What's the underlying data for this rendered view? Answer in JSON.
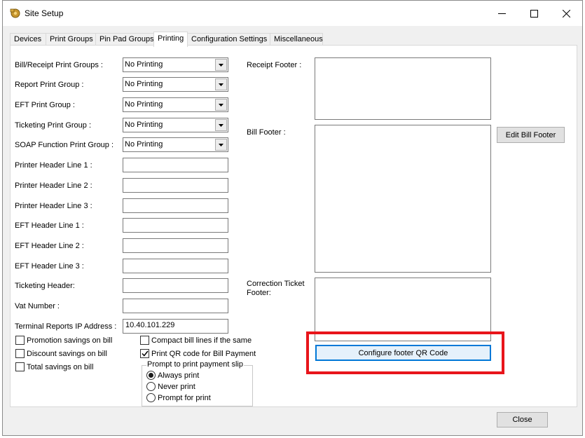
{
  "window": {
    "title": "Site Setup"
  },
  "tabs": [
    {
      "label": "Devices",
      "active": false
    },
    {
      "label": "Print Groups",
      "active": false
    },
    {
      "label": "Pin Pad Groups",
      "active": false
    },
    {
      "label": "Printing",
      "active": true
    },
    {
      "label": "Configuration Settings",
      "active": false
    },
    {
      "label": "Miscellaneous",
      "active": false
    }
  ],
  "form": {
    "bill_receipt_print_groups": {
      "label": "Bill/Receipt Print Groups :",
      "value": "No Printing"
    },
    "report_print_group": {
      "label": "Report Print Group :",
      "value": "No Printing"
    },
    "eft_print_group": {
      "label": "EFT Print Group :",
      "value": "No Printing"
    },
    "ticketing_print_group": {
      "label": "Ticketing Print Group :",
      "value": "No Printing"
    },
    "soap_function_print_group": {
      "label": "SOAP Function Print Group :",
      "value": "No Printing"
    },
    "printer_header_line_1": {
      "label": "Printer Header Line 1 :",
      "value": ""
    },
    "printer_header_line_2": {
      "label": "Printer Header Line 2 :",
      "value": ""
    },
    "printer_header_line_3": {
      "label": "Printer Header Line 3 :",
      "value": ""
    },
    "eft_header_line_1": {
      "label": "EFT Header Line 1 :",
      "value": ""
    },
    "eft_header_line_2": {
      "label": "EFT Header Line 2 :",
      "value": ""
    },
    "eft_header_line_3": {
      "label": "EFT Header Line 3 :",
      "value": ""
    },
    "ticketing_header": {
      "label": "Ticketing Header:",
      "value": ""
    },
    "vat_number": {
      "label": "Vat Number :",
      "value": ""
    },
    "terminal_reports_ip": {
      "label": "Terminal Reports IP Address :",
      "value": "10.40.101.229"
    }
  },
  "footers": {
    "receipt_footer": {
      "label": "Receipt Footer :",
      "value": ""
    },
    "bill_footer": {
      "label": "Bill Footer :",
      "value": ""
    },
    "correction_ticket_footer": {
      "label": "Correction Ticket Footer:",
      "value": ""
    },
    "edit_bill_footer_label": "Edit Bill Footer",
    "configure_qr_label": "Configure footer QR Code"
  },
  "checkboxes": {
    "promotion_savings": {
      "label": "Promotion savings on bill",
      "checked": false
    },
    "discount_savings": {
      "label": "Discount savings on bill",
      "checked": false
    },
    "total_savings": {
      "label": "Total savings on bill",
      "checked": false
    },
    "compact_bill_lines": {
      "label": "Compact bill lines if the same",
      "checked": false
    },
    "print_qr_code": {
      "label": "Print QR code for Bill Payment",
      "checked": true
    }
  },
  "payment_slip": {
    "title": "Prompt to print payment slip",
    "options": [
      {
        "label": "Always print",
        "selected": true
      },
      {
        "label": "Never print",
        "selected": false
      },
      {
        "label": "Prompt for print",
        "selected": false
      }
    ]
  },
  "footer_buttons": {
    "close_label": "Close"
  },
  "colors": {
    "highlight": "#e8151b",
    "focus": "#0078d7"
  }
}
